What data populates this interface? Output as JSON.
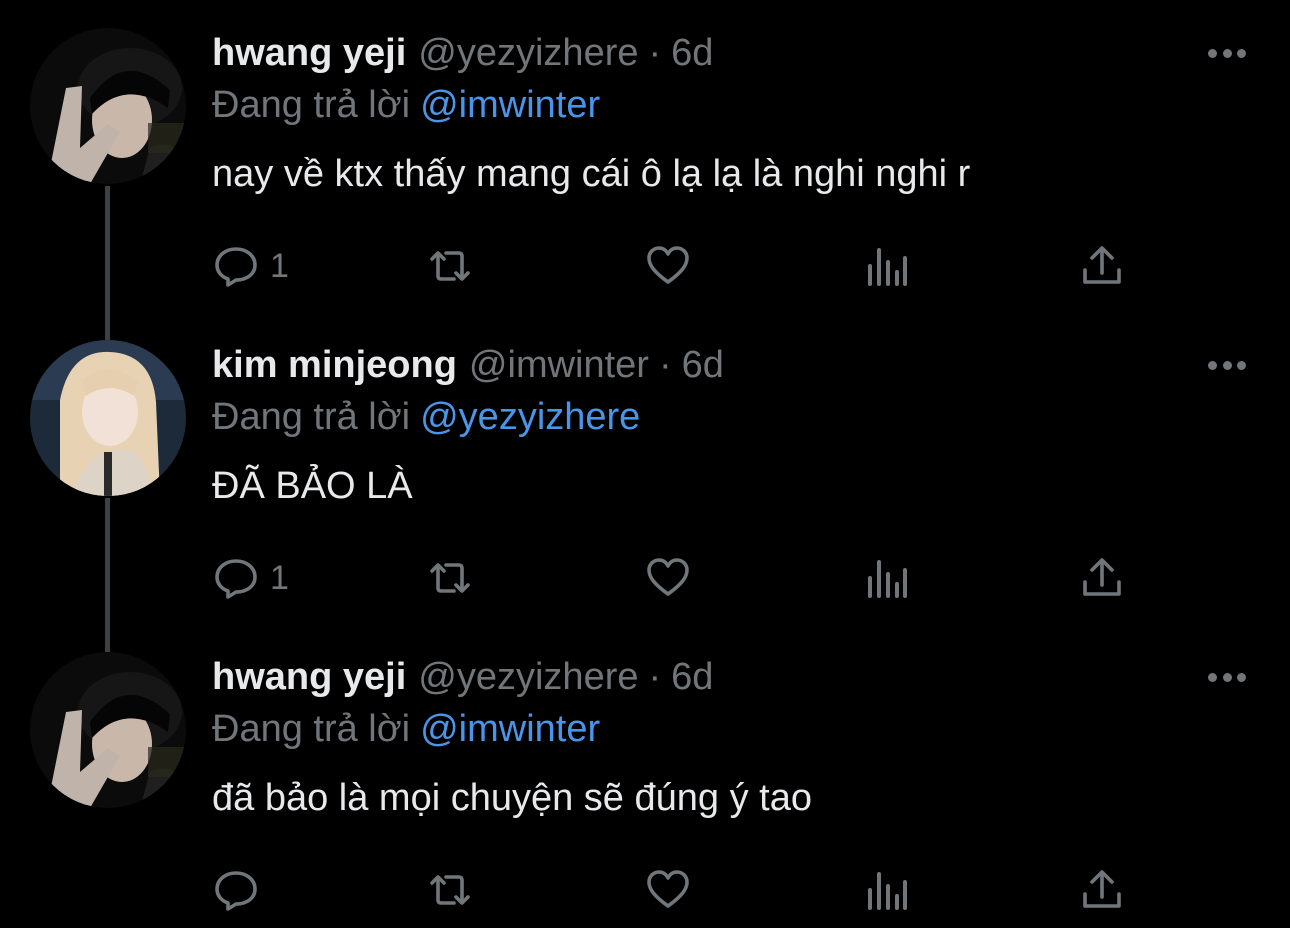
{
  "tweets": [
    {
      "avatar_name": "avatar-hwang-yeji",
      "name": "hwang yeji",
      "handle": "@yezyizhere",
      "separator": "·",
      "time": "6d",
      "replying_prefix": "Đang trả lời",
      "replying_to": "@imwinter",
      "text": "nay về ktx thấy mang cái ô lạ lạ là nghi nghi r",
      "reply_count": "1"
    },
    {
      "avatar_name": "avatar-kim-minjeong",
      "name": "kim minjeong",
      "handle": "@imwinter",
      "separator": "·",
      "time": "6d",
      "replying_prefix": "Đang trả lời",
      "replying_to": "@yezyizhere",
      "text": "ĐÃ BẢO LÀ",
      "reply_count": "1"
    },
    {
      "avatar_name": "avatar-hwang-yeji",
      "name": "hwang yeji",
      "handle": "@yezyizhere",
      "separator": "·",
      "time": "6d",
      "replying_prefix": "Đang trả lời",
      "replying_to": "@imwinter",
      "text": "đã bảo là mọi chuyện sẽ đúng ý tao",
      "reply_count": ""
    }
  ],
  "icons": {
    "reply": "speech-bubble-icon",
    "retweet": "retweet-icon",
    "like": "heart-icon",
    "views": "bar-chart-icon",
    "share": "share-upload-icon",
    "more": "ellipsis-icon"
  },
  "colors": {
    "background": "#000000",
    "text_primary": "#e7e9ea",
    "text_secondary": "#71767b",
    "link": "#4b95e8",
    "thread_line": "#3e4144"
  }
}
